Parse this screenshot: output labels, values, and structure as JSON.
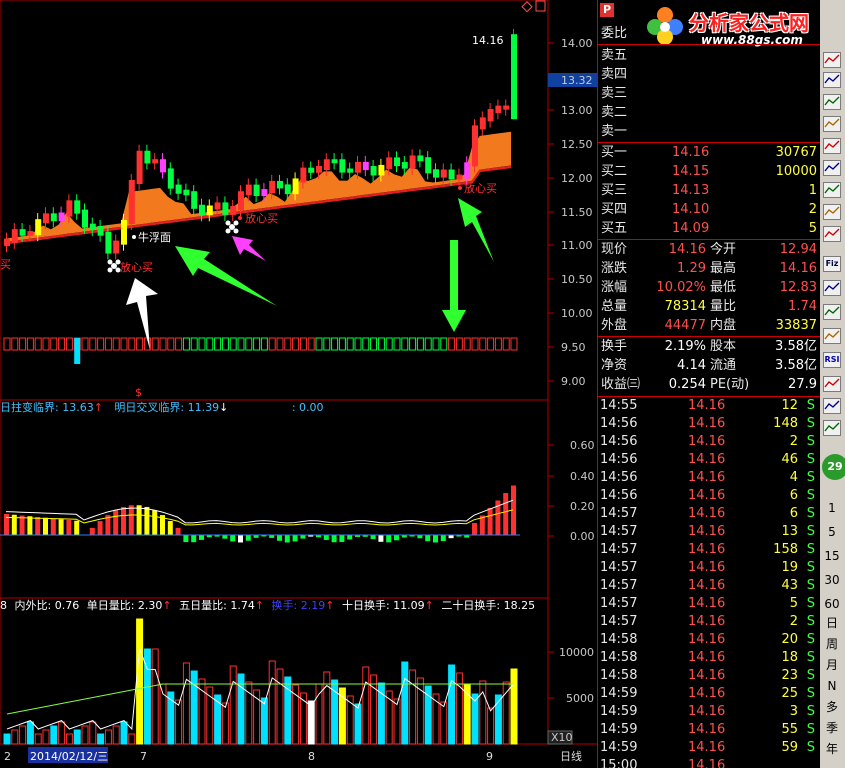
{
  "watermark": {
    "brand": "分析家公式网",
    "url": "www.88gs.com"
  },
  "price_panel": {
    "y_ticks": [
      "14.00",
      "13.00",
      "12.50",
      "12.00",
      "11.50",
      "11.00",
      "10.50",
      "10.00",
      "9.50",
      "9.00"
    ],
    "current_price": "13.32",
    "high_label": "14.16",
    "annotations": [
      {
        "text": "放心买"
      },
      {
        "text": "牛浮面"
      },
      {
        "text": "放心买"
      },
      {
        "text": "放心买"
      },
      {
        "text": "买"
      }
    ],
    "marker": "$"
  },
  "macd_panel": {
    "header": [
      {
        "text": "日拄变临界: 13.63",
        "arrow": "↑",
        "color": "#40c0ff"
      },
      {
        "text": "明日交叉临界: 11.39",
        "arrow": "↓",
        "color": "#40c0ff"
      },
      {
        "text": ": 0.00",
        "color": "#40c0ff"
      }
    ],
    "y_ticks": [
      "0.60",
      "0.40",
      "0.20",
      "0.00"
    ]
  },
  "volume_panel": {
    "header": [
      {
        "text": "8",
        "color": "#ffffff"
      },
      {
        "text": "内外比: 0.76",
        "color": "#ffffff"
      },
      {
        "text": "单日量比: 2.30",
        "arrow": "↑",
        "color": "#ffffff"
      },
      {
        "text": "五日量比: 1.74",
        "arrow": "↑",
        "color": "#ffffff"
      },
      {
        "text": "换手: 2.19",
        "arrow": "↑",
        "color": "#4040ff"
      },
      {
        "text": "十日换手: 11.09",
        "arrow": "↑",
        "color": "#ffffff"
      },
      {
        "text": "二十日换手: 18.25",
        "color": "#ffffff"
      }
    ],
    "y_ticks": [
      "10000",
      "5000"
    ],
    "unit": "X10"
  },
  "date_axis": {
    "labels": [
      "2",
      "2014/02/12/三",
      "7",
      "8",
      "9"
    ],
    "period": "日线"
  },
  "quote": {
    "wei_bi": "委比",
    "sell": [
      {
        "label": "卖五"
      },
      {
        "label": "卖四"
      },
      {
        "label": "卖三"
      },
      {
        "label": "卖二"
      },
      {
        "label": "卖一"
      }
    ],
    "buy": [
      {
        "label": "买一",
        "price": "14.16",
        "vol": "30767"
      },
      {
        "label": "买二",
        "price": "14.15",
        "vol": "10000"
      },
      {
        "label": "买三",
        "price": "14.13",
        "vol": "1"
      },
      {
        "label": "买四",
        "price": "14.10",
        "vol": "2"
      },
      {
        "label": "买五",
        "price": "14.09",
        "vol": "5"
      }
    ],
    "stats": [
      {
        "l1": "现价",
        "v1": "14.16",
        "l2": "今开",
        "v2": "12.94"
      },
      {
        "l1": "涨跌",
        "v1": "1.29",
        "l2": "最高",
        "v2": "14.16"
      },
      {
        "l1": "涨幅",
        "v1": "10.02%",
        "l2": "最低",
        "v2": "12.83"
      },
      {
        "l1": "总量",
        "v1": "78314",
        "l2": "量比",
        "v2": "1.74"
      },
      {
        "l1": "外盘",
        "v1": "44477",
        "l2": "内盘",
        "v2": "33837"
      }
    ],
    "stats2": [
      {
        "l1": "换手",
        "v1": "2.19%",
        "l2": "股本",
        "v2": "3.58亿"
      },
      {
        "l1": "净资",
        "v1": "4.14",
        "l2": "流通",
        "v2": "3.58亿"
      },
      {
        "l1": "收益㈢",
        "v1": "0.254",
        "l2": "PE(动)",
        "v2": "27.9"
      }
    ],
    "ticks": [
      {
        "t": "14:55",
        "p": "14.16",
        "v": "12",
        "s": "S"
      },
      {
        "t": "14:56",
        "p": "14.16",
        "v": "148",
        "s": "S"
      },
      {
        "t": "14:56",
        "p": "14.16",
        "v": "2",
        "s": "S"
      },
      {
        "t": "14:56",
        "p": "14.16",
        "v": "46",
        "s": "S"
      },
      {
        "t": "14:56",
        "p": "14.16",
        "v": "4",
        "s": "S"
      },
      {
        "t": "14:56",
        "p": "14.16",
        "v": "6",
        "s": "S"
      },
      {
        "t": "14:57",
        "p": "14.16",
        "v": "6",
        "s": "S"
      },
      {
        "t": "14:57",
        "p": "14.16",
        "v": "13",
        "s": "S"
      },
      {
        "t": "14:57",
        "p": "14.16",
        "v": "158",
        "s": "S"
      },
      {
        "t": "14:57",
        "p": "14.16",
        "v": "19",
        "s": "S"
      },
      {
        "t": "14:57",
        "p": "14.16",
        "v": "43",
        "s": "S"
      },
      {
        "t": "14:57",
        "p": "14.16",
        "v": "5",
        "s": "S"
      },
      {
        "t": "14:57",
        "p": "14.16",
        "v": "2",
        "s": "S"
      },
      {
        "t": "14:58",
        "p": "14.16",
        "v": "20",
        "s": "S"
      },
      {
        "t": "14:58",
        "p": "14.16",
        "v": "18",
        "s": "S"
      },
      {
        "t": "14:58",
        "p": "14.16",
        "v": "23",
        "s": "S"
      },
      {
        "t": "14:59",
        "p": "14.16",
        "v": "25",
        "s": "S"
      },
      {
        "t": "14:59",
        "p": "14.16",
        "v": "3",
        "s": "S"
      },
      {
        "t": "14:59",
        "p": "14.16",
        "v": "55",
        "s": "S"
      },
      {
        "t": "14:59",
        "p": "14.16",
        "v": "59",
        "s": "S"
      },
      {
        "t": "15:00",
        "p": "14.16",
        "v": "",
        "s": ""
      }
    ]
  },
  "toolbar": {
    "icon_labels": [
      "Fiz",
      "RSI"
    ],
    "badge": "29",
    "periods": [
      "1",
      "5",
      "15",
      "30",
      "60"
    ],
    "units": [
      "日",
      "周",
      "月",
      "N",
      "多",
      "季",
      "年"
    ]
  },
  "colors": {
    "up": "#ff3030",
    "down": "#00e0ff",
    "green": "#00ff40",
    "yellow": "#ffff00",
    "orange": "#ff8020",
    "magenta": "#ff40ff",
    "panel_border": "#c00000"
  }
}
